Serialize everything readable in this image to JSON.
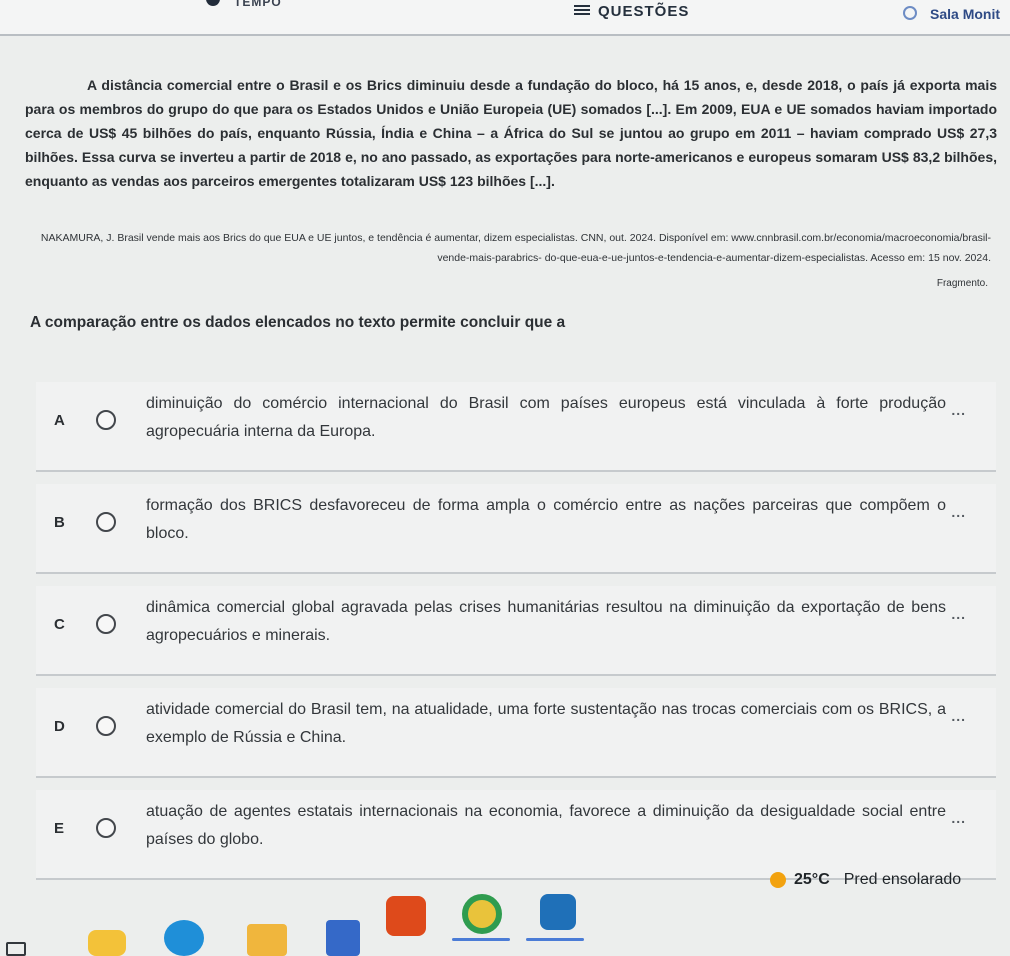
{
  "header": {
    "tempo_label": "TEMPO",
    "questions_label": "QUESTÕES",
    "room_label": "Sala Monit"
  },
  "passage": "A distância comercial entre o Brasil e os Brics diminuiu desde a fundação do bloco, há 15 anos, e, desde 2018, o país já exporta mais para os membros do grupo do que para os Estados Unidos e União Europeia (UE) somados [...]. Em 2009, EUA e UE somados haviam importado cerca de US$ 45 bilhões do país, enquanto Rússia, Índia e China – a África do Sul se juntou ao grupo em 2011 – haviam comprado US$ 27,3 bilhões. Essa curva se inverteu a partir de 2018 e, no ano passado, as exportações para norte-americanos e europeus somaram US$ 83,2 bilhões, enquanto as vendas aos parceiros emergentes totalizaram US$ 123 bilhões [...].",
  "reference": "NAKAMURA, J. Brasil vende mais aos Brics do que EUA e UE juntos, e tendência é aumentar, dizem especialistas. CNN, out. 2024. Disponível em: www.cnnbrasil.com.br/economia/macroeconomia/brasil-vende-mais-parabrics- do-que-eua-e-ue-juntos-e-tendencia-e-aumentar-dizem-especialistas. Acesso em: 15 nov. 2024.",
  "fragment_label": "Fragmento.",
  "prompt": "A comparação entre os dados elencados no texto permite concluir que a",
  "options": [
    {
      "letter": "A",
      "text": "diminuição do comércio internacional do Brasil com países europeus está vinculada à forte produção agropecuária interna da Europa."
    },
    {
      "letter": "B",
      "text": "formação dos BRICS desfavoreceu de forma ampla o comércio entre as nações parceiras que compõem o bloco."
    },
    {
      "letter": "C",
      "text": "dinâmica comercial global agravada pelas crises humanitárias resultou na diminuição da exportação de bens agropecuários e minerais."
    },
    {
      "letter": "D",
      "text": "atividade comercial do Brasil tem, na atualidade, uma forte sustentação nas trocas comerciais com os BRICS, a exemplo de Rússia e China."
    },
    {
      "letter": "E",
      "text": "atuação de agentes estatais internacionais na economia, favorece a diminuição da desigualdade social entre países do globo."
    }
  ],
  "more_label": "...",
  "taskbar": {
    "temperature": "25°C",
    "weather_text": "Pred ensolarado"
  }
}
